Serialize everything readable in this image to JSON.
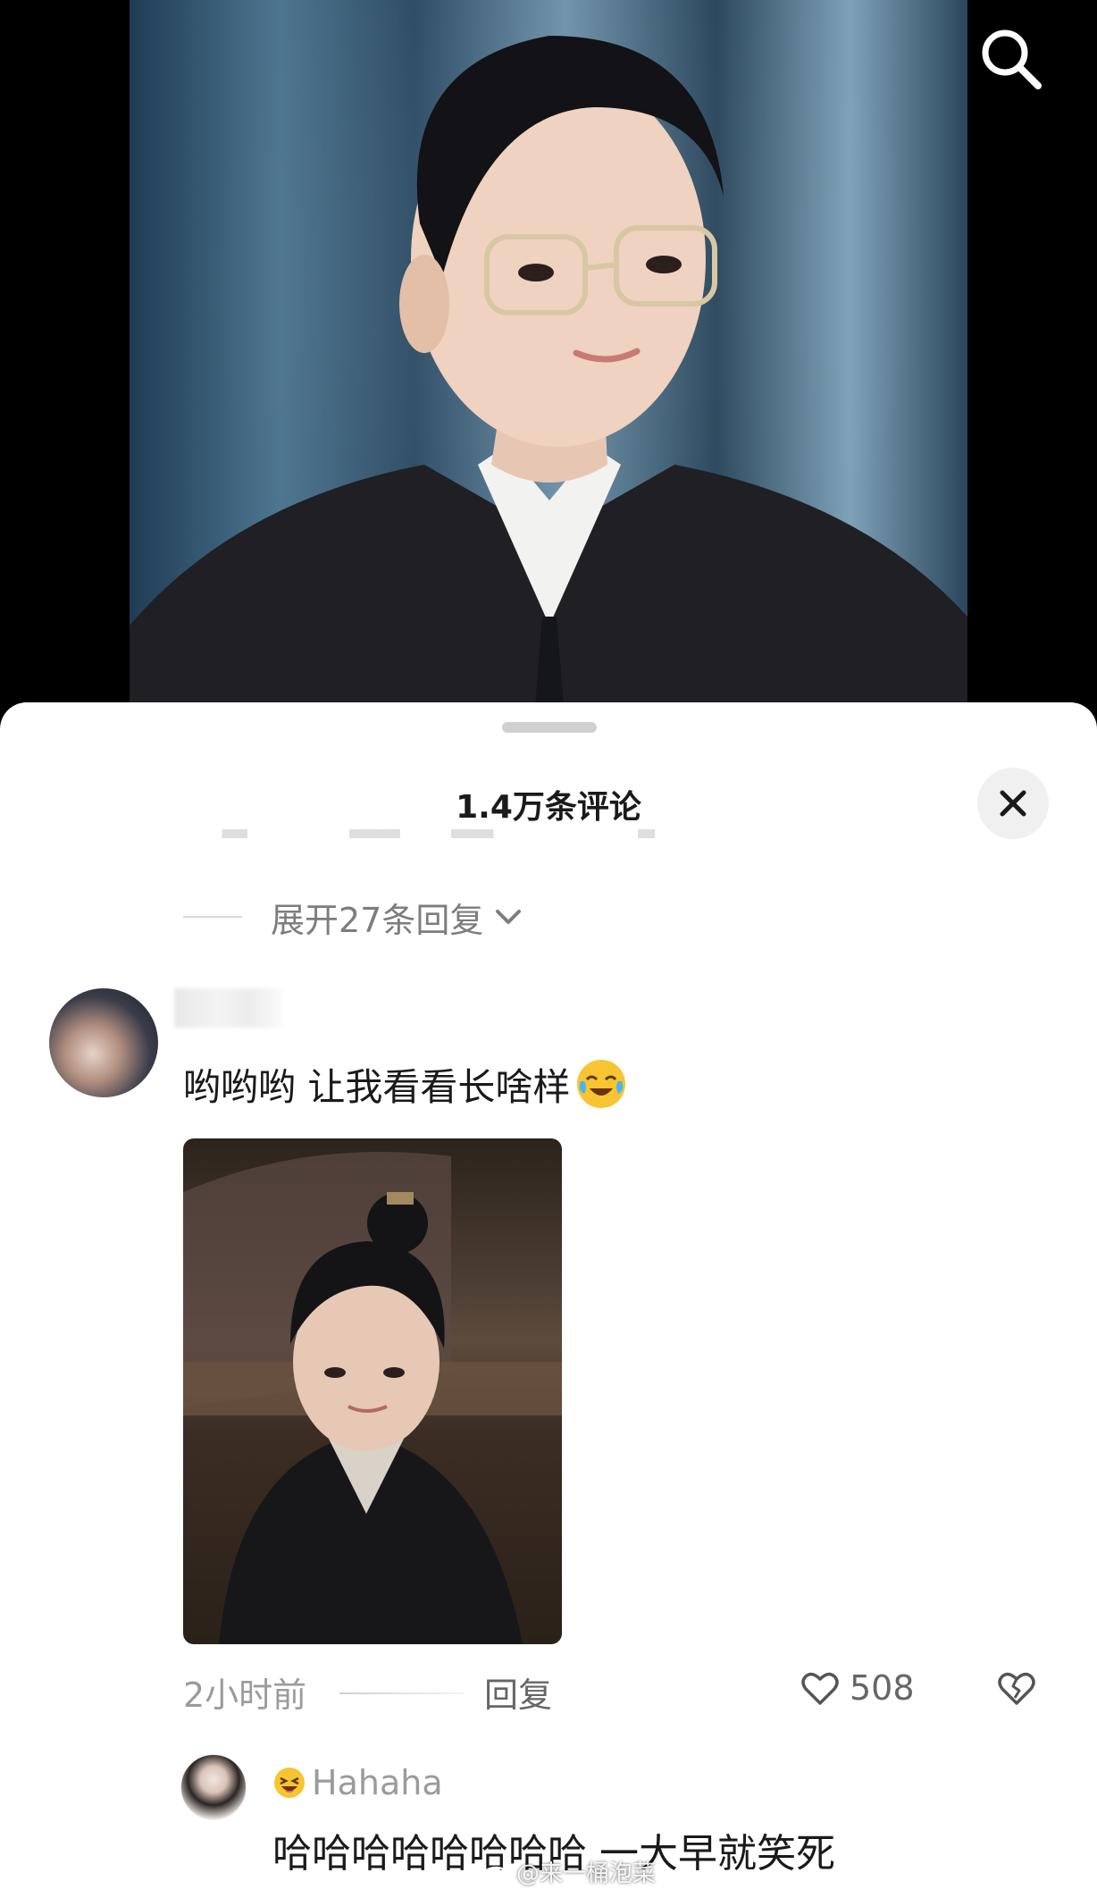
{
  "video": {
    "has_search": true
  },
  "comments_sheet": {
    "title": "1.4万条评论",
    "expand_replies": "展开27条回复"
  },
  "comment": {
    "text": "哟哟哟 让我看看长啥样",
    "time": "2小时前",
    "reply_label": "回复",
    "like_count": "508"
  },
  "reply": {
    "username": "Hahaha",
    "text": "哈哈哈哈哈哈哈哈   一大早就笑死"
  },
  "watermark": {
    "text": "@来一桶泡菜"
  }
}
